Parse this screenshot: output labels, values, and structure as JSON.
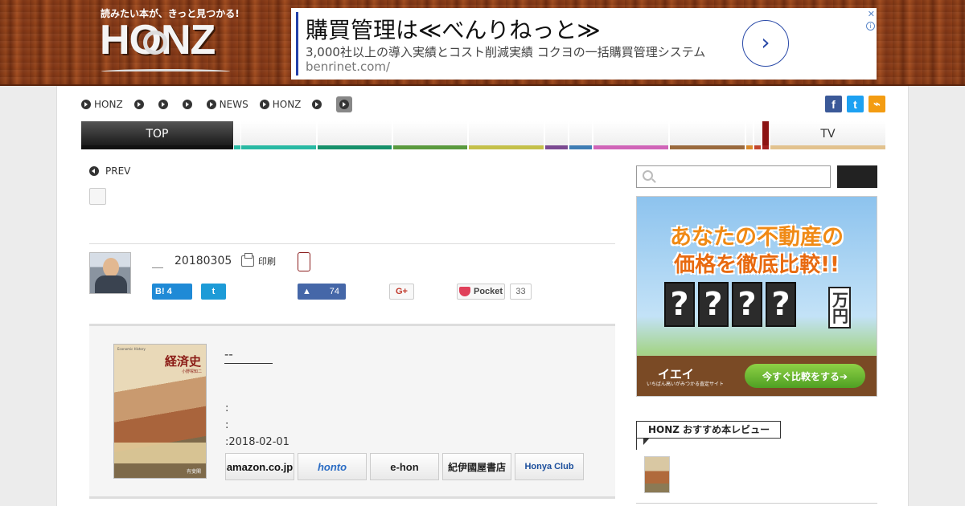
{
  "header": {
    "tagline": "読みたい本が、きっと見つかる!",
    "logo": "HONZ"
  },
  "ad_banner": {
    "title": "購買管理は≪べんりねっと≫",
    "description": "3,000社以上の導入実績とコスト削減実績 コクヨの一括購買管理システム",
    "url": "benrinet.com/",
    "arrow": "›",
    "close": "✕",
    "info": "i"
  },
  "breadcrumb": {
    "items": [
      "HONZ",
      "",
      "",
      "",
      "NEWS",
      "HONZ",
      "",
      ""
    ]
  },
  "social": {
    "facebook": "f",
    "twitter": "t",
    "rss": "⌁"
  },
  "nav": {
    "top_label": "TOP",
    "tv_label": "TV",
    "colors": [
      "#29b9a3",
      "#1a9c84",
      "#16906a",
      "#5a9a3e",
      "#c4c04a",
      "#7b4a91",
      "#3f7db4",
      "#d065b8",
      "#9a6a3e",
      "#d98a2b",
      "#c2452c",
      "#a01f1f",
      "#e2c28e"
    ]
  },
  "article": {
    "prev_label": "PREV",
    "author": "＿",
    "date": "20180305",
    "print_label": "印刷"
  },
  "share": {
    "hatena_label": "B!",
    "hatena_count": "4",
    "twitter_label": "t",
    "facebook_count": "74",
    "google_label": "G+",
    "pocket_label": "Pocket",
    "pocket_count": "33"
  },
  "book": {
    "title": "--",
    "meta_line1": ":",
    "meta_line2": ":",
    "meta_line3": ":2018-02-01",
    "cover_title": "経済史",
    "cover_head": "Economic History",
    "cover_sub": "小野塚知二",
    "cover_publisher": "有斐閣",
    "stores": [
      "amazon.co.jp",
      "honto",
      "e-hon",
      "紀伊國屋書店",
      "Honya Club"
    ]
  },
  "sidebar": {
    "ad_line1": "あなたの不動産の",
    "ad_line2": "価格を徹底比較!!",
    "ad_q": [
      "?",
      "?",
      "?",
      "?"
    ],
    "ad_unit": "万円",
    "ad_brand": "イエイ",
    "ad_brand_sub": "いちばん高いがみつかる査定サイト",
    "ad_cta": "今すぐ比較をする➔",
    "recommend_label": "HONZ おすすめ本レビュー"
  }
}
